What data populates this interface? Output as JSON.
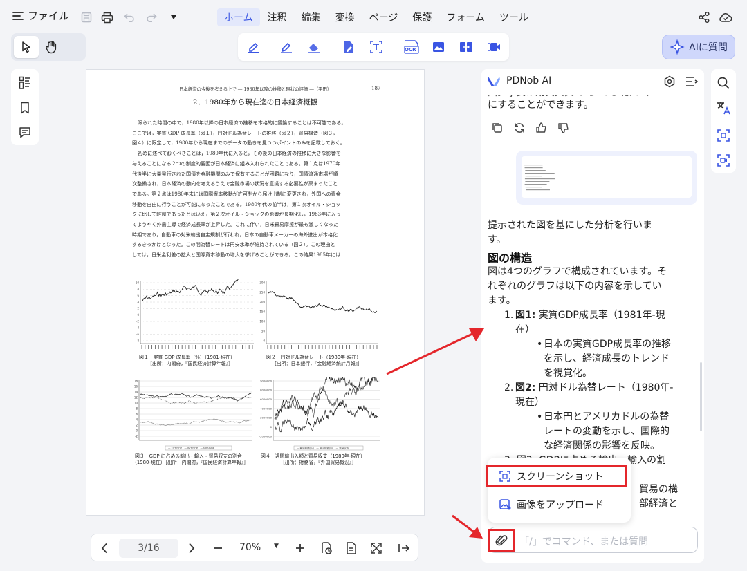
{
  "menubar": {
    "file_label": "ファイル",
    "tabs": [
      "ホーム",
      "注釈",
      "編集",
      "変換",
      "ページ",
      "保護",
      "フォーム",
      "ツール"
    ],
    "active_tab": "ホーム"
  },
  "toolbar": {
    "ai_button_label": "AIに質問",
    "ocr_label": "OCR"
  },
  "document": {
    "running_head": "日本経済の今後を考える上で ― 1980年以降の推移と現状の評価 ―（平田）",
    "page_number": "187",
    "section_title": "2．1980年から現在迄の日本経済概観",
    "paragraphs": [
      "限られた時間の中で，1980年以降の日本経済の推移を本格的に議論することは不可能である。",
      "ここでは，実質 GDP 成長率（図１），円対ドル為替レートの推移（図２），貿易構造（図３，",
      "図４）に限定して，1980年から現在までのデータの動きを見つつポイントのみを記載しておく。",
      "初めに述べておくべきことは，1980年代に入ると，その後の日本経済の推移に大きな影響を",
      "与えることになる２つの制度的要因が日本経済に組み入れられたことである。第１点は1970年",
      "代後半に大量発行された国債を金融機関のみで保有することが困難になり，国債流通市場が順",
      "次整備され，日本経済の動向を考えるうえで金融市場の状況を意識する必要性が高まったこと",
      "である。第２点は1980年末には国際資本移動が許可制から届け出制に変更され，外国への資金",
      "移動を自由に行うことが可能になったことである。1980年代の前半は，第１次オイル・ショッ",
      "クに比して軽微であったとはいえ，第２次オイル・ショックの影響が長期化し，1983年に入っ",
      "てようやく外需主導で経済成長率が上昇した。これに伴い，日米貿易摩擦が最も激しくなった",
      "時期であり，自動車の対米輸出自主規制が行われ，日本の自動車メーカーの海外進出が本格化",
      "するきっかけとなった。この間為替レートは円安水準が維持されている（図２）。この理由と",
      "しては，日米金利差の拡大と国際資本移動の増大を挙げることができる。この結果1985年には"
    ],
    "fig1_caption": "図１　実質 GDP 成長率（%）（1981-現在）",
    "fig1_source": "［出所：内閣府，『国民経済計算年報』］",
    "fig2_caption": "図２　円対ドル為替レート（1980年-現在）",
    "fig2_source": "［出所：日本銀行，『金融経済統計月報』］",
    "fig3_caption": "図３　GDP に占める輸出・輸入・貿易収支の割合",
    "fig3_source": "（1980-現在）［出所：内閣府，『国民経済計算年報』］",
    "fig4_caption": "図４　週間輸出入額と貿易収支（1980年-現在）",
    "fig4_source": "［出所：財務省，『外国貿易概況』］",
    "fig1_yticks": [
      "10",
      "8",
      "6",
      "4",
      "2",
      "0",
      "-2",
      "-4",
      "-6",
      "-8"
    ],
    "fig2_yticks": [
      "300",
      "250",
      "200",
      "150",
      "100",
      "50",
      "0"
    ],
    "fig3_yticks": [
      "18",
      "16",
      "14",
      "12",
      "10",
      "8",
      "6",
      "4",
      "2",
      "0",
      "-2"
    ],
    "fig4_yticks": [
      "9000000",
      "8000000",
      "6000000",
      "4000000",
      "2000000",
      "0",
      "-2000000"
    ],
    "fig3_legend": "— EXT/GDP　— IMT/GDP　— NXT/GDP",
    "fig4_legend": "— 輸出総額(円)　— 輸入総額(円)　— 貿易収支"
  },
  "pagenav": {
    "page_value": "3/16",
    "zoom_value": "70%"
  },
  "ai_panel": {
    "title": "PDNob AI",
    "partial_top_line": "図。 J 良け効黄贝黄で ち くし 版の ァ",
    "msg1_line2": "にすることができます。",
    "reply_intro_1": "提示された図を基にした分析を行いま",
    "reply_intro_2": "す。",
    "heading": "図の構造",
    "struct_1": "図は4つのグラフで構成されています。そ",
    "struct_2": "れぞれのグラフは以下の内容を示してい",
    "struct_3": "ます。",
    "item1_label": "図1:",
    "item1_rest": " 実質GDP成長率（1981年-現",
    "item1_cont": "在）",
    "item1_bullet_1": "日本の実質GDP成長率の推移",
    "item1_bullet_2": "を示し、経済成長のトレンド",
    "item1_bullet_3": "を視覚化。",
    "item2_label": "図2:",
    "item2_rest": " 円対ドル為替レート（1980年-",
    "item2_cont": "現在）",
    "item2_bullet_1": "日本円とアメリカドルの為替",
    "item2_bullet_2": "レートの変動を示し、国際的",
    "item2_bullet_3": "な経済関係の影響を反映。",
    "item3_partial": "図3: GDPに占める輸出・輸入の割",
    "hidden_tail_1": "貿易の構",
    "hidden_tail_2": "部経済と",
    "input_placeholder": "「/」でコマンド、または質問",
    "menu_screenshot": "スクリーンショット",
    "menu_upload": "画像をアップロード"
  },
  "colors": {
    "accent": "#3a55e3",
    "highlight_red": "#e4262b",
    "ai_button_bg": "#cfd7fb"
  }
}
